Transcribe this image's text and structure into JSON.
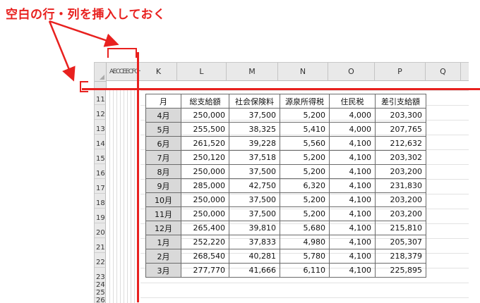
{
  "caption": "空白の行・列を挿入しておく",
  "narrow_headers": "AECCEECFCHCI",
  "columns": [
    "K",
    "L",
    "M",
    "N",
    "O",
    "P",
    "Q"
  ],
  "rows_before": [
    "11",
    "12",
    "13",
    "14",
    "15",
    "16",
    "17",
    "18",
    "19",
    "20",
    "21",
    "22",
    "23",
    "24",
    "25",
    "26"
  ],
  "table": {
    "headers": [
      "月",
      "総支給額",
      "社会保険料",
      "源泉所得税",
      "住民税",
      "差引支給額"
    ],
    "rows": [
      [
        "4月",
        "250,000",
        "37,500",
        "5,200",
        "4,000",
        "203,300"
      ],
      [
        "5月",
        "255,500",
        "38,325",
        "5,410",
        "4,000",
        "207,765"
      ],
      [
        "6月",
        "261,520",
        "39,228",
        "5,560",
        "4,100",
        "212,632"
      ],
      [
        "7月",
        "250,120",
        "37,518",
        "5,200",
        "4,100",
        "203,302"
      ],
      [
        "8月",
        "250,000",
        "37,500",
        "5,200",
        "4,100",
        "203,200"
      ],
      [
        "9月",
        "285,000",
        "42,750",
        "6,320",
        "4,100",
        "231,830"
      ],
      [
        "10月",
        "250,000",
        "37,500",
        "5,200",
        "4,100",
        "203,200"
      ],
      [
        "11月",
        "250,000",
        "37,500",
        "5,200",
        "4,100",
        "203,200"
      ],
      [
        "12月",
        "265,400",
        "39,810",
        "5,680",
        "4,100",
        "215,810"
      ],
      [
        "1月",
        "252,220",
        "37,833",
        "4,980",
        "4,100",
        "205,307"
      ],
      [
        "2月",
        "268,540",
        "40,281",
        "5,780",
        "4,100",
        "218,379"
      ],
      [
        "3月",
        "277,770",
        "41,666",
        "6,110",
        "4,100",
        "225,895"
      ]
    ]
  },
  "colors": {
    "annotation": "#e8211f",
    "header_bg": "#e9e9e9",
    "month_bg": "#d9d9d9"
  }
}
